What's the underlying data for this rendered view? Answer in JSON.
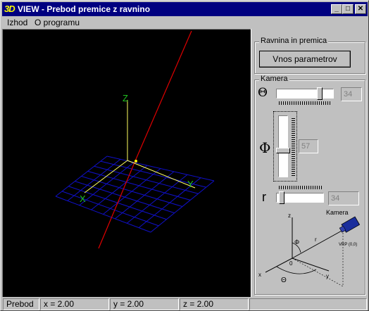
{
  "window": {
    "app_icon_text": "3D",
    "title": "VIEW - Prebod premice z ravnino",
    "controls": {
      "minimize": "_",
      "maximize": "□",
      "close": "✕"
    }
  },
  "menu": {
    "items": [
      {
        "label": "Izhod"
      },
      {
        "label": "O programu"
      }
    ]
  },
  "scene": {
    "axis_labels": {
      "z": "Z",
      "x": "X",
      "y": "Y"
    },
    "colors": {
      "plane_grid": "#1010c8",
      "axes": "#ffff60",
      "axis_letters": "#20c020",
      "line": "#e00000",
      "background": "#000000"
    }
  },
  "panel": {
    "plane_group": {
      "title": "Ravnina in premica",
      "button": "Vnos parametrov"
    },
    "camera_group": {
      "title": "Kamera",
      "theta": {
        "symbol": "Θ",
        "value": "34",
        "slider_fraction": 0.79
      },
      "phi": {
        "symbol": "Φ",
        "value": "57",
        "slider_fraction": 0.58
      },
      "r": {
        "symbol": "r",
        "value": "34",
        "slider_fraction": 0.05
      },
      "diagram": {
        "camera_label": "Kamera",
        "z_label": "z",
        "phi_label": "Φ",
        "r_label": "r",
        "origin_label": "0",
        "vrp_label": "VRP (0,0)",
        "x_label": "x",
        "y_label": "y",
        "theta_label": "Θ"
      }
    }
  },
  "status": {
    "mode": "Prebod",
    "x": "x =  2.00",
    "y": "y =  2.00",
    "z": "z =  2.00"
  }
}
